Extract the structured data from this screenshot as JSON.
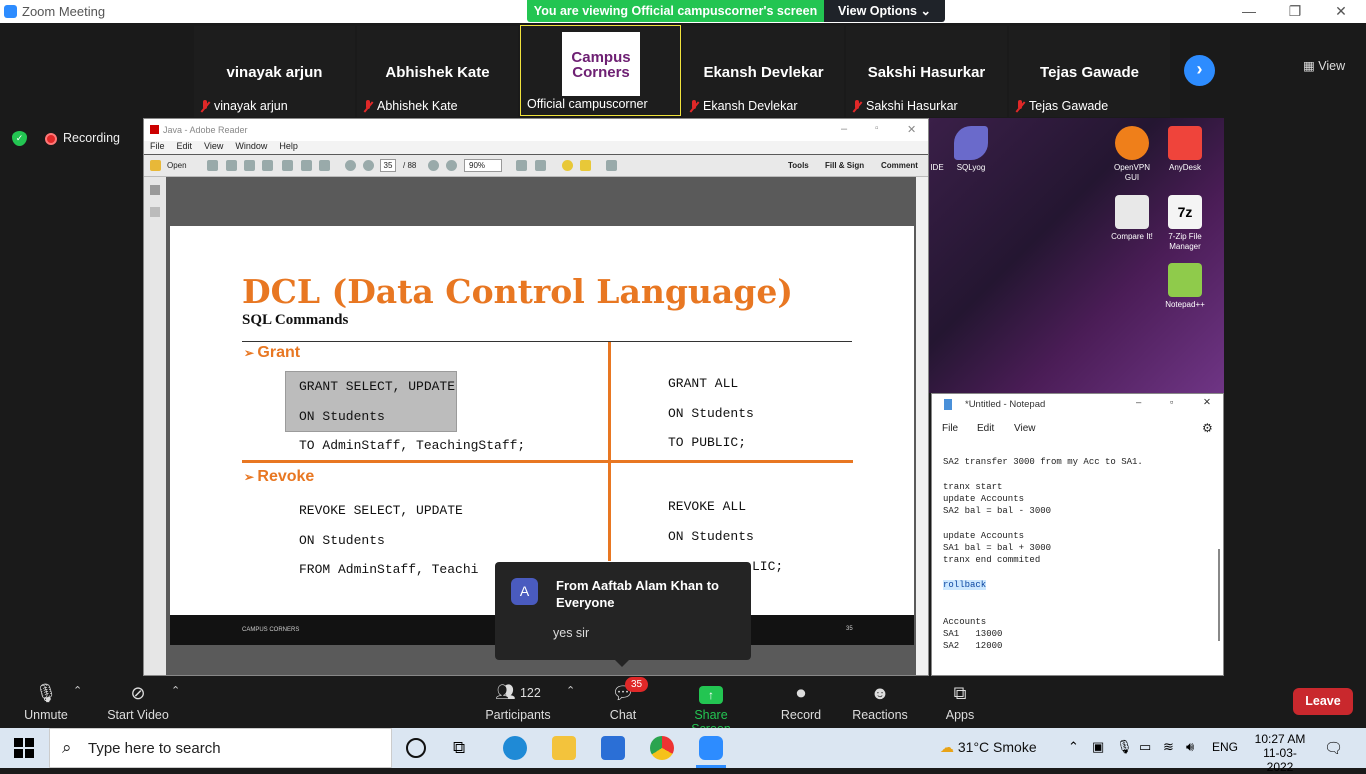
{
  "window": {
    "title": "Zoom Meeting"
  },
  "share_banner": {
    "text": "You are viewing Official campuscorner's screen",
    "view_options": "View Options"
  },
  "gallery": {
    "participants": [
      {
        "big_name": "vinayak arjun",
        "label": "vinayak arjun"
      },
      {
        "big_name": "Abhishek Kate",
        "label": "Abhishek Kate"
      },
      {
        "big_name": "",
        "label": "Official campuscorner",
        "logo_text": "Campus Corners"
      },
      {
        "big_name": "Ekansh Devlekar",
        "label": "Ekansh Devlekar"
      },
      {
        "big_name": "Sakshi Hasurkar",
        "label": "Sakshi Hasurkar"
      },
      {
        "big_name": "Tejas Gawade",
        "label": "Tejas Gawade"
      }
    ],
    "view_label": "View"
  },
  "recording": {
    "label": "Recording"
  },
  "adobe": {
    "title": "Java - Adobe Reader",
    "menu": [
      "File",
      "Edit",
      "View",
      "Window",
      "Help"
    ],
    "toolbar": {
      "open": "Open",
      "page": "35",
      "total": "/ 88",
      "zoom": "90%",
      "tools": "Tools",
      "fill_sign": "Fill & Sign",
      "comment": "Comment"
    },
    "slide": {
      "title": "DCL (Data Control Language)",
      "subtitle": "SQL Commands",
      "grant_heading": "Grant",
      "grant_left": [
        "GRANT SELECT, UPDATE",
        "ON Students",
        "TO AdminStaff, TeachingStaff;"
      ],
      "grant_right": [
        "GRANT ALL",
        "ON Students",
        "TO PUBLIC;"
      ],
      "revoke_heading": "Revoke",
      "revoke_left": [
        "REVOKE SELECT, UPDATE",
        "ON Students",
        "FROM  AdminStaff, Teachi"
      ],
      "revoke_right": [
        "REVOKE ALL",
        "ON Students",
        "LIC;"
      ],
      "footer_brand": "CAMPUS CORNERS",
      "footer_page": "35"
    }
  },
  "desktop_icons": [
    {
      "label": "IDE",
      "color": "#2b2b2b"
    },
    {
      "label": "SQLyog",
      "color": "#6a6acb"
    },
    {
      "label": "OpenVPN GUI",
      "color": "#ef7f1a"
    },
    {
      "label": "AnyDesk",
      "color": "#ef443b"
    },
    {
      "label": "Compare It!",
      "color": "#e8e8e8"
    },
    {
      "label": "7-Zip File Manager",
      "color": "#1a1a1a"
    },
    {
      "label": "Notepad++",
      "color": "#8fcb4b"
    }
  ],
  "notepad": {
    "title": "*Untitled - Notepad",
    "menu": [
      "File",
      "Edit",
      "View"
    ],
    "text_before": "SA2 transfer 3000 from my Acc to SA1.\n\ntranx start\nupdate Accounts\nSA2 bal = bal - 3000\n\nupdate Accounts\nSA1 bal = bal + 3000\ntranx end commited\n\n",
    "highlight": "rollback",
    "text_after": "\n\n\nAccounts\nSA1   13000\nSA2   12000"
  },
  "chat_popup": {
    "avatar": "A",
    "from": "From Aaftab Alam Khan to Everyone",
    "message": "yes sir"
  },
  "toolbar": {
    "unmute": "Unmute",
    "start_video": "Start Video",
    "participants": "Participants",
    "participants_count": "122",
    "chat": "Chat",
    "chat_badge": "35",
    "share_screen": "Share Screen",
    "record": "Record",
    "reactions": "Reactions",
    "apps": "Apps",
    "leave": "Leave"
  },
  "taskbar": {
    "search_placeholder": "Type here to search",
    "weather": "31°C  Smoke",
    "lang": "ENG",
    "time": "10:27 AM",
    "date": "11-03-2022"
  },
  "colors": {
    "zoom_blue": "#2d8cff",
    "share_green": "#23c552",
    "leave_red": "#c9282d",
    "slide_orange": "#e87722"
  }
}
